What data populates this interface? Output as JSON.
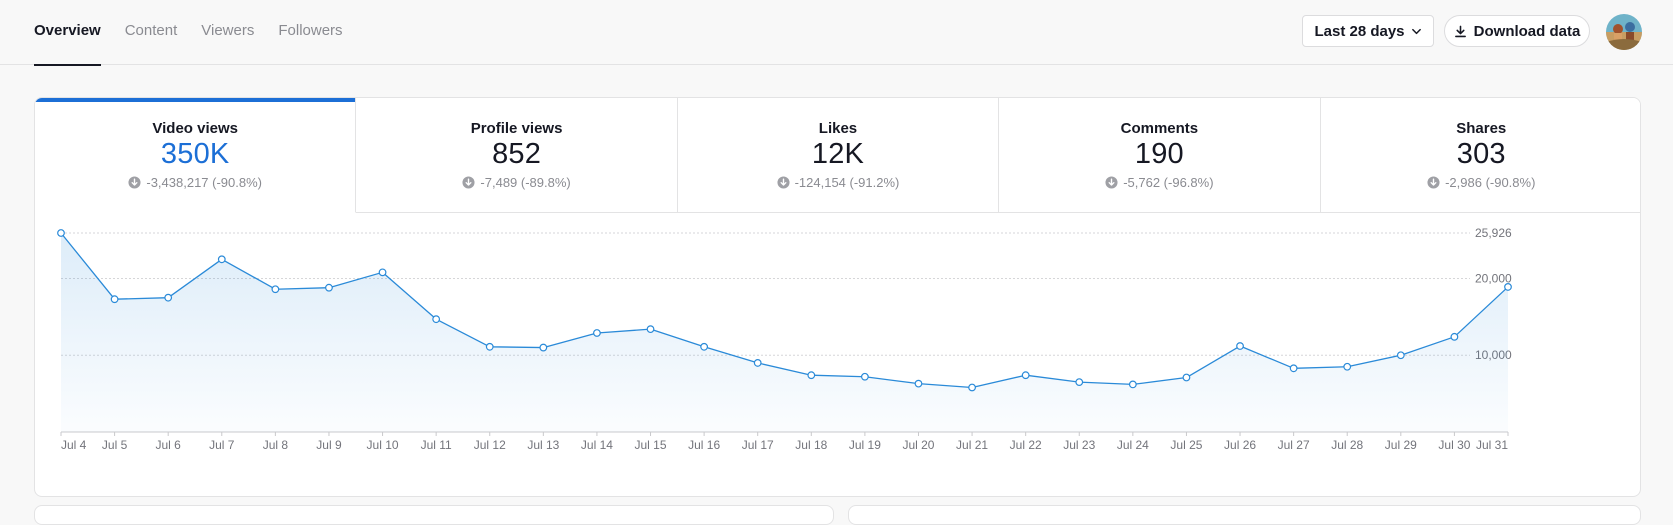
{
  "nav": {
    "tabs": [
      {
        "label": "Overview",
        "active": true
      },
      {
        "label": "Content",
        "active": false
      },
      {
        "label": "Viewers",
        "active": false
      },
      {
        "label": "Followers",
        "active": false
      }
    ],
    "date_range_label": "Last 28 days",
    "download_label": "Download data"
  },
  "metrics": [
    {
      "label": "Video views",
      "value": "350K",
      "delta": "-3,438,217 (-90.8%)",
      "active": true
    },
    {
      "label": "Profile views",
      "value": "852",
      "delta": "-7,489 (-89.8%)",
      "active": false
    },
    {
      "label": "Likes",
      "value": "12K",
      "delta": "-124,154 (-91.2%)",
      "active": false
    },
    {
      "label": "Comments",
      "value": "190",
      "delta": "-5,762 (-96.8%)",
      "active": false
    },
    {
      "label": "Shares",
      "value": "303",
      "delta": "-2,986 (-90.8%)",
      "active": false
    }
  ],
  "colors": {
    "accent": "#1c6fd6",
    "line": "#2a8ad8",
    "text": "#161823",
    "muted": "#8a8b91"
  },
  "chart_data": {
    "type": "area",
    "title": "",
    "xlabel": "",
    "ylabel": "",
    "categories": [
      "Jul 4",
      "Jul 5",
      "Jul 6",
      "Jul 7",
      "Jul 8",
      "Jul 9",
      "Jul 10",
      "Jul 11",
      "Jul 12",
      "Jul 13",
      "Jul 14",
      "Jul 15",
      "Jul 16",
      "Jul 17",
      "Jul 18",
      "Jul 19",
      "Jul 20",
      "Jul 21",
      "Jul 22",
      "Jul 23",
      "Jul 24",
      "Jul 25",
      "Jul 26",
      "Jul 27",
      "Jul 28",
      "Jul 29",
      "Jul 30",
      "Jul 31"
    ],
    "values": [
      25926,
      17300,
      17500,
      22500,
      18600,
      18800,
      20800,
      14700,
      11100,
      11000,
      12900,
      13400,
      11100,
      9000,
      7400,
      7200,
      6300,
      5800,
      7400,
      6500,
      6200,
      7100,
      11200,
      8300,
      8500,
      10000,
      12400,
      18900
    ],
    "y_ticks": [
      {
        "value": 25926,
        "label": "25,926"
      },
      {
        "value": 20000,
        "label": "20,000"
      },
      {
        "value": 10000,
        "label": "10,000"
      }
    ],
    "ylim": [
      0,
      25926
    ],
    "y_axis_side": "right",
    "grid": true
  }
}
